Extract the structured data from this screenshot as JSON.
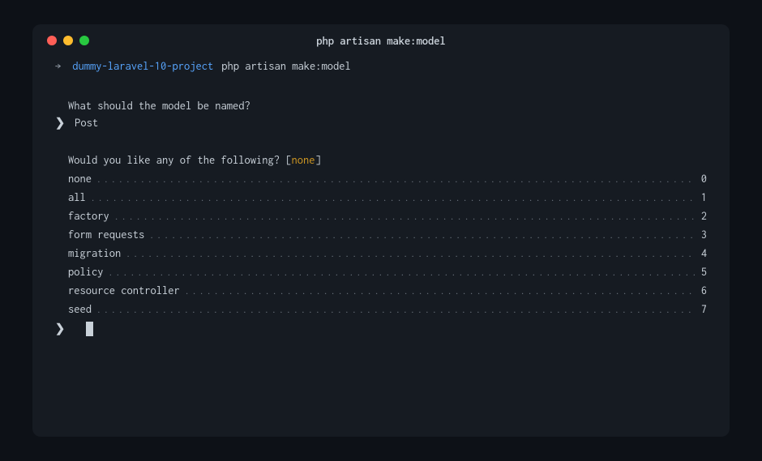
{
  "window": {
    "title": "php artisan make:model"
  },
  "prompt": {
    "arrow": "→",
    "cwd": "dummy-laravel-10-project",
    "command": "php artisan make:model"
  },
  "question1": {
    "text": "What should the model be named?",
    "caret": "❯",
    "value": "Post"
  },
  "question2": {
    "text": "Would you like any of the following? ",
    "bracket_open": "[",
    "default": "none",
    "bracket_close": "]"
  },
  "options": [
    {
      "label": "none",
      "number": "0"
    },
    {
      "label": "all",
      "number": "1"
    },
    {
      "label": "factory",
      "number": "2"
    },
    {
      "label": "form requests",
      "number": "3"
    },
    {
      "label": "migration",
      "number": "4"
    },
    {
      "label": "policy",
      "number": "5"
    },
    {
      "label": "resource controller",
      "number": "6"
    },
    {
      "label": "seed",
      "number": "7"
    }
  ],
  "input_caret": "❯"
}
